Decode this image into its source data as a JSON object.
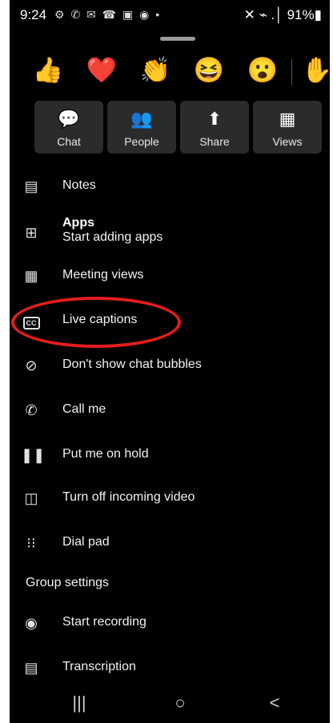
{
  "status": {
    "time": "9:24",
    "notification_icons": "⚙ ✆ ✉ ☎ ▣ ◉ •",
    "right": "✕ ⌁ .│ 91%▮"
  },
  "reactions": [
    {
      "icon": "thumbs-up",
      "glyph": "👍"
    },
    {
      "icon": "heart",
      "glyph": "❤️"
    },
    {
      "icon": "clapping-hands",
      "glyph": "👏"
    },
    {
      "icon": "laughing-face",
      "glyph": "😆"
    },
    {
      "icon": "surprised-face",
      "glyph": "😮"
    },
    {
      "icon": "raise-hand",
      "glyph": "✋"
    }
  ],
  "tiles": [
    {
      "label": "Chat",
      "icon": "chat-icon",
      "glyph": "💬"
    },
    {
      "label": "People",
      "icon": "people-icon",
      "glyph": "👥"
    },
    {
      "label": "Share",
      "icon": "share-icon",
      "glyph": "⬆"
    },
    {
      "label": "Views",
      "icon": "views-icon",
      "glyph": "▦"
    }
  ],
  "menu": {
    "notes": "Notes",
    "apps_title": "Apps",
    "apps_subtitle": "Start adding apps",
    "meeting_views": "Meeting views",
    "live_captions": "Live captions",
    "live_captions_icon_text": "CC",
    "chat_bubbles": "Don't show chat bubbles",
    "call_me": "Call me",
    "hold": "Put me on hold",
    "incoming_video": "Turn off incoming video",
    "dial_pad": "Dial pad",
    "group_settings": "Group settings",
    "start_recording": "Start recording",
    "transcription": "Transcription"
  },
  "highlight_color": "#e21d1d",
  "navbar": {
    "recents": "|||",
    "home": "○",
    "back": "<"
  }
}
